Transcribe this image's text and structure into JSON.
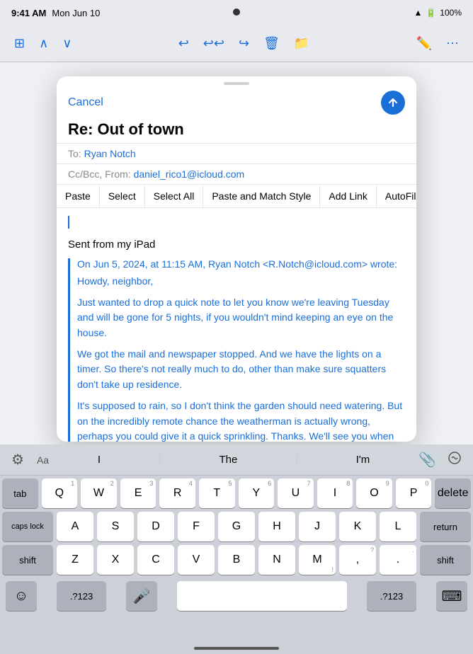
{
  "statusBar": {
    "time": "9:41 AM",
    "date": "Mon Jun 10",
    "battery": "100%",
    "signal": "●●●●"
  },
  "toolbar": {
    "sidebar": "⊞",
    "up": "∧",
    "down": "∨",
    "reply": "↩",
    "replyAll": "↩↩",
    "forward": "↪",
    "trash": "🗑",
    "folder": "📁",
    "compose": "✏",
    "more": "⋯"
  },
  "compose": {
    "cancelLabel": "Cancel",
    "subject": "Re: Out of town",
    "toLabel": "To:",
    "toValue": "Ryan Notch",
    "ccBccLabel": "Cc/Bcc, From:",
    "ccBccValue": "daniel_rico1@icloud.com",
    "contextMenu": {
      "paste": "Paste",
      "select": "Select",
      "selectAll": "Select All",
      "pasteMatch": "Paste and Match Style",
      "addLink": "Add Link",
      "autoFill": "AutoFill",
      "chevron": "›"
    },
    "signatureText": "Sent from my iPad",
    "quotedHeader": "On Jun 5, 2024, at 11:15 AM, Ryan Notch <R.Notch@icloud.com> wrote:",
    "quotedParagraphs": [
      "Howdy, neighbor,",
      "Just wanted to drop a quick note to let you know we're leaving Tuesday and will be gone for 5 nights, if you wouldn't mind keeping an eye on the house.",
      "We got the mail and newspaper stopped. And we have the lights on a timer. So there's not really much to do, other than make sure squatters don't take up residence.",
      "It's supposed to rain, so I don't think the garden should need watering. But on the incredibly remote chance the weatherman is actually wrong, perhaps you could give it a quick sprinkling. Thanks. We'll see you when we get back!"
    ]
  },
  "keyboard": {
    "predictions": [
      "I",
      "The",
      "I'm"
    ],
    "rows": [
      [
        "Q",
        "W",
        "E",
        "R",
        "T",
        "Y",
        "U",
        "I",
        "O",
        "P"
      ],
      [
        "A",
        "S",
        "D",
        "F",
        "G",
        "H",
        "J",
        "K",
        "L"
      ],
      [
        "Z",
        "X",
        "C",
        "V",
        "B",
        "N",
        "M"
      ]
    ],
    "numbers": [
      [
        "1",
        "2",
        "3",
        "4",
        "5",
        "6",
        "7",
        "8",
        "9",
        "0"
      ],
      [
        "",
        "",
        "",
        "",
        "",
        "",
        "",
        "",
        "",
        ""
      ],
      [
        "",
        "",
        "",
        "",
        "",
        "",
        ""
      ]
    ],
    "tabLabel": "tab",
    "capsLabel": "caps lock",
    "shiftLabel": "shift",
    "deleteLabel": "delete",
    "returnLabel": "return",
    "spaceLabel": "",
    "emojiLabel": "☺",
    "numSymLabel": ".?123",
    "micLabel": "🎤",
    "keyboardLabel": "⌨"
  }
}
